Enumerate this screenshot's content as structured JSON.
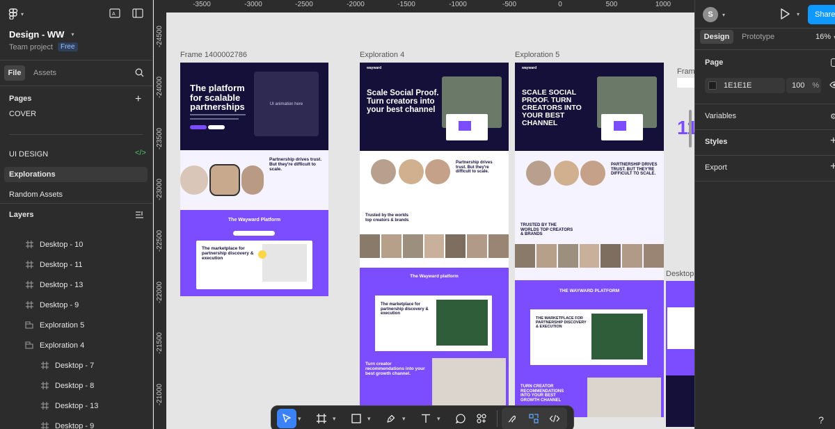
{
  "left": {
    "file_name": "Design - WW",
    "project": "Team project",
    "plan_badge": "Free",
    "tabs": {
      "file": "File",
      "assets": "Assets"
    },
    "pages_title": "Pages",
    "pages": [
      "COVER",
      "UI DESIGN",
      "Explorations",
      "Random Assets"
    ],
    "layers_title": "Layers",
    "layers": [
      {
        "label": "Desktop - 10",
        "type": "frame",
        "indent": 1
      },
      {
        "label": "Desktop - 11",
        "type": "frame",
        "indent": 1
      },
      {
        "label": "Desktop - 13",
        "type": "frame",
        "indent": 1
      },
      {
        "label": "Desktop - 9",
        "type": "frame",
        "indent": 1
      },
      {
        "label": "Exploration 5",
        "type": "section",
        "indent": 1
      },
      {
        "label": "Exploration 4",
        "type": "section",
        "indent": 1
      },
      {
        "label": "Desktop - 7",
        "type": "frame",
        "indent": 2
      },
      {
        "label": "Desktop - 8",
        "type": "frame",
        "indent": 2
      },
      {
        "label": "Desktop - 13",
        "type": "frame",
        "indent": 2
      },
      {
        "label": "Desktop - 9",
        "type": "frame",
        "indent": 2
      }
    ]
  },
  "ruler": {
    "x_ticks": [
      "-3500",
      "-3000",
      "-2500",
      "-2000",
      "-1500",
      "-1000",
      "-500",
      "0",
      "500",
      "1000"
    ],
    "y_ticks": [
      "-24500",
      "-24000",
      "-23500",
      "-23000",
      "-22500",
      "-22000",
      "-21500",
      "-21000"
    ]
  },
  "canvas": {
    "frames": {
      "f1": "Frame 1400002786",
      "f2": "Exploration 4",
      "f3": "Exploration 5",
      "f4": "Frame",
      "f5": "Desktop"
    },
    "f1_hero": "The platform for scalable partnerships",
    "f1_ui_note": "UI animation here",
    "f1_trust": "Partnership drives trust. But they're difficult to scale.",
    "f1_platform": "The Wayward Platform",
    "f1_market": "The marketplace for partnership discovery & execution",
    "f2_hero": "Scale Social Proof. Turn creators into your best channel",
    "f2_trust": "Partnership drives trust. But they're difficult to scale.",
    "f2_trusted": "Trusted by the worlds top creators & brands",
    "f2_platform": "The Wayward platform",
    "f2_market": "The marketplace for partnership discovery & execution",
    "f2_turn": "Turn creator recommendations into your best growth channel.",
    "f3_hero": "SCALE SOCIAL PROOF. TURN CREATORS INTO YOUR BEST CHANNEL",
    "f3_trust": "PARTNERSHIP DRIVES TRUST. BUT THEY'RE DIFFICULT TO SCALE.",
    "f3_trusted": "TRUSTED BY THE WORLDS TOP CREATORS & BRANDS",
    "f3_platform": "THE WAYWARD PLATFORM",
    "f3_market": "THE MARKETPLACE FOR PARTNERSHIP DISCOVERY & EXECUTION",
    "f3_turn": "TURN CREATOR RECOMMENDATIONS INTO YOUR BEST GROWTH CHANNEL",
    "logo_text": "wayward"
  },
  "right": {
    "avatar_initial": "S",
    "share": "Share",
    "tabs": {
      "design": "Design",
      "prototype": "Prototype"
    },
    "zoom": "16%",
    "page_title": "Page",
    "page_color": "1E1E1E",
    "page_opacity": "100",
    "percent": "%",
    "variables": "Variables",
    "styles": "Styles",
    "export": "Export"
  },
  "colors": {
    "purple": "#7c4dff",
    "navy": "#14103a",
    "blue": "#3b82f6"
  }
}
